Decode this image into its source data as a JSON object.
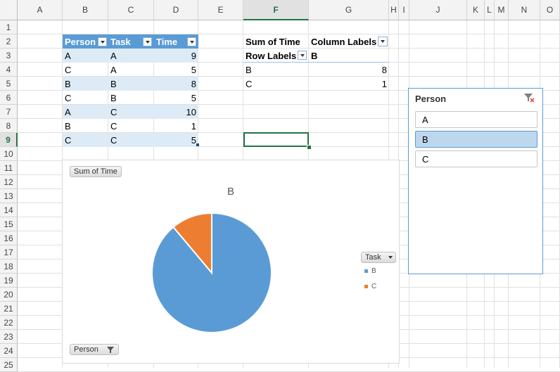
{
  "sheet": {
    "columns": [
      "A",
      "B",
      "C",
      "D",
      "E",
      "F",
      "G",
      "H",
      "I",
      "J",
      "K",
      "L",
      "M",
      "N",
      "O"
    ],
    "rows": [
      "1",
      "2",
      "3",
      "4",
      "5",
      "6",
      "7",
      "8",
      "9",
      "10",
      "11",
      "12",
      "13",
      "14",
      "15",
      "16",
      "17",
      "18",
      "19",
      "20",
      "21",
      "22",
      "23",
      "24",
      "25"
    ],
    "active_column": "F",
    "active_row": "9"
  },
  "table": {
    "headers": [
      "Person",
      "Task",
      "Time"
    ],
    "rows": [
      {
        "person": "A",
        "task": "A",
        "time": "9"
      },
      {
        "person": "C",
        "task": "A",
        "time": "5"
      },
      {
        "person": "B",
        "task": "B",
        "time": "8"
      },
      {
        "person": "C",
        "task": "B",
        "time": "5"
      },
      {
        "person": "A",
        "task": "C",
        "time": "10"
      },
      {
        "person": "B",
        "task": "C",
        "time": "1"
      },
      {
        "person": "C",
        "task": "C",
        "time": "5"
      }
    ]
  },
  "pivot": {
    "value_field": "Sum of Time",
    "column_labels": "Column Labels",
    "row_labels": "Row Labels",
    "column_value": "B",
    "rows": [
      {
        "label": "B",
        "value": "8"
      },
      {
        "label": "C",
        "value": "1"
      }
    ]
  },
  "chart": {
    "value_button": "Sum of Time",
    "axis_button": "Person",
    "legend_button": "Task",
    "colors": {
      "B": "#5b9bd5",
      "C": "#ed7d31"
    }
  },
  "chart_data": {
    "type": "pie",
    "title": "B",
    "categories": [
      "B",
      "C"
    ],
    "values": [
      8,
      1
    ],
    "legend": "right"
  },
  "slicer": {
    "title": "Person",
    "items": [
      "A",
      "B",
      "C"
    ],
    "selected": "B"
  }
}
